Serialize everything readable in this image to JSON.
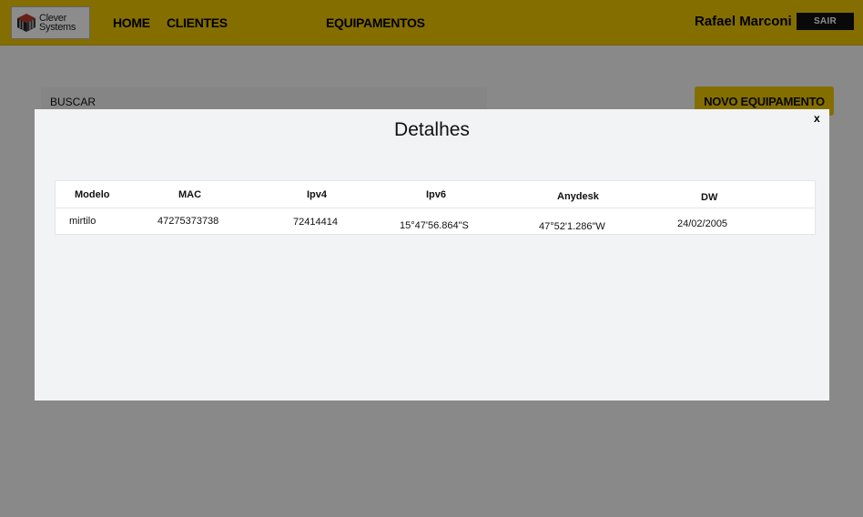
{
  "navbar": {
    "logo": {
      "line1": "Clever",
      "line2": "Systems"
    },
    "links": [
      {
        "label": "HOME"
      },
      {
        "label": "CLIENTES"
      },
      {
        "label": "EQUIPAMENTOS"
      }
    ],
    "user_name": "Rafael Marconi",
    "logout_label": "SAIR"
  },
  "main": {
    "search_placeholder": "BUSCAR",
    "new_button_label": "NOVO EQUIPAMENTO"
  },
  "modal": {
    "title": "Detalhes",
    "close_label": "x",
    "columns": [
      "Modelo",
      "MAC",
      "Ipv4",
      "Ipv6",
      "Anydesk",
      "DW"
    ],
    "rows": [
      [
        "mirtilo",
        "47275373738",
        "72414414",
        "15°47'56.864\"S",
        "47°52'1.286\"W",
        "24/02/2005"
      ]
    ]
  },
  "colors": {
    "brand_yellow": "#f0c800",
    "overlay": "#000000",
    "modal_bg": "#f2f3f5"
  }
}
